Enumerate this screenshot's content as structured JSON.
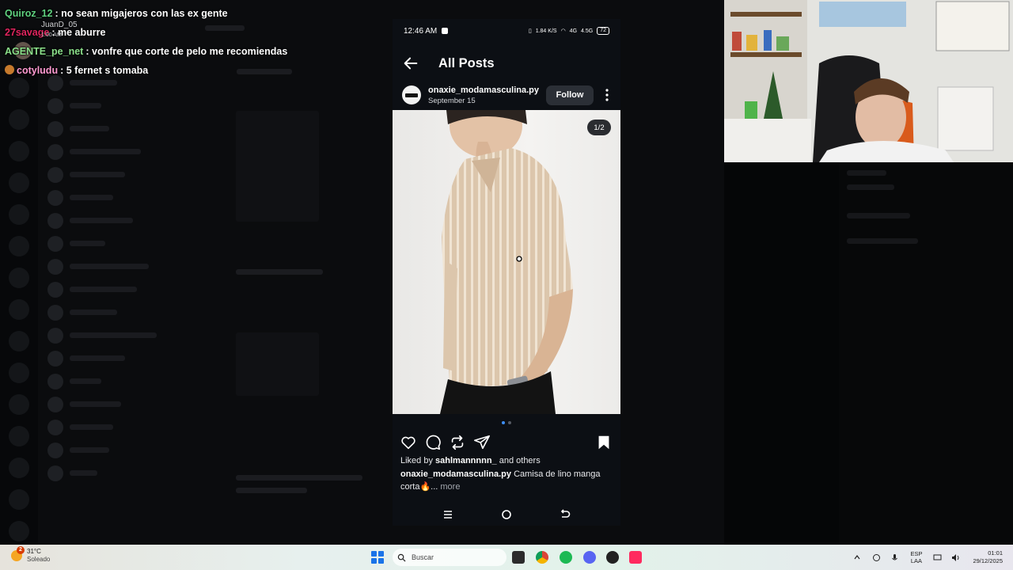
{
  "chat": {
    "lines": [
      {
        "user": "Quiroz_12",
        "sep": ":",
        "msg": "no sean migajeros con las ex gente",
        "color": "#5fd27f"
      },
      {
        "user": "27savage",
        "sep": ":",
        "msg": "me aburre",
        "color": "#e0245e"
      },
      {
        "user": "AGENTE_pe_net",
        "sep": ":",
        "msg": "vonfre que corte de pelo me recomiendas",
        "color": "#8be08a"
      },
      {
        "user": "cotyludu",
        "sep": ":",
        "msg": "5 fernet s tomaba",
        "color": "#ff9ad2"
      }
    ],
    "ghost_user": "JuanD_05",
    "ghost_time": "1:00 AM"
  },
  "phone": {
    "status": {
      "time": "12:46 AM",
      "net": "1.84 K/S",
      "signal": "4G",
      "signal2": "4.5G",
      "battery": "72"
    },
    "header": {
      "title": "All Posts"
    },
    "post": {
      "username": "onaxie_modamasculina.py",
      "date": "September 15",
      "follow_label": "Follow",
      "counter": "1/2",
      "liked_prefix": "Liked by",
      "liked_user": "sahlmannnnn_",
      "liked_suffix": "and others",
      "caption_user": "onaxie_modamasculina.py",
      "caption_text": "Camisa de lino manga corta🔥",
      "caption_ellipsis": "...",
      "more_label": "more"
    }
  },
  "taskbar": {
    "weather_temp": "31°C",
    "weather_desc": "Soleado",
    "weather_badge": "2",
    "search_placeholder": "Buscar",
    "lang_1": "ESP",
    "lang_2": "LAA",
    "time": "01:01",
    "date": "29/12/2025",
    "accent": "#1a73e8"
  }
}
